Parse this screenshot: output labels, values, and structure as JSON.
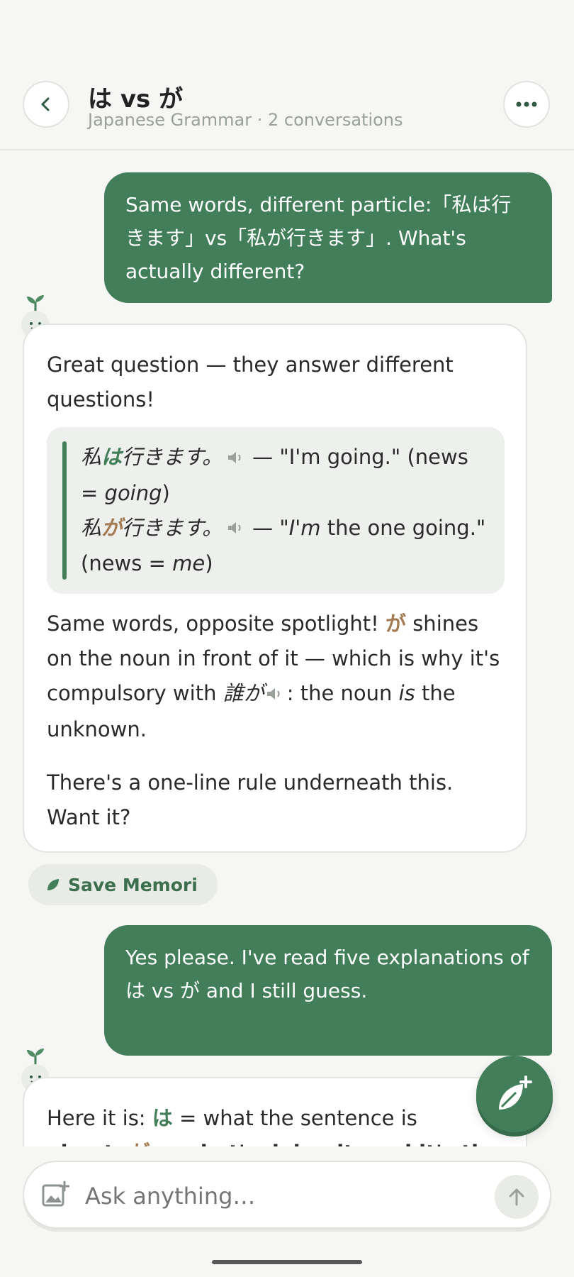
{
  "header": {
    "title": "は vs が",
    "subtitle": "Japanese Grammar · 2 conversations",
    "back_icon": "chevron-left-icon",
    "more_icon": "ellipsis-icon"
  },
  "messages": {
    "user1": "Same words, different particle:「私は行きます」vs「私が行きます」. What's actually different?",
    "bot1": {
      "intro": "Great question — they answer different questions!",
      "q1_pre": "私",
      "q1_particle": "は",
      "q1_post": "行きます。",
      "q1_dash": "— \"I'm going.\" (news = ",
      "q1_em": "going",
      "q1_end": ")",
      "q2_pre": "私",
      "q2_particle": "が",
      "q2_post": "行きます。",
      "q2_dash": "— \"",
      "q2_em": "I'm",
      "q2_mid": " the one going.\" (news = ",
      "q2_em2": "me",
      "q2_end": ")",
      "p2_a": "Same words, opposite spotlight! ",
      "p2_ga": "が",
      "p2_b": " shines on the noun in front of it — which is why it's compulsory with ",
      "p2_jp": "誰が",
      "p2_c": ": the noun ",
      "p2_em": "is",
      "p2_d": " the unknown.",
      "p3": "There's a one-line rule underneath this. Want it?"
    },
    "save_label": "Save Memori",
    "user2": "Yes please. I've read five explanations of は vs が and I still guess.",
    "bot2": {
      "a": "Here it is: ",
      "wa": "は",
      "b": " = what the sentence is",
      "line2_a": "about; ",
      "line2_ga": "が",
      "line2_b": " = what's doing it, and it's the"
    }
  },
  "input": {
    "placeholder": "Ask anything…"
  },
  "colors": {
    "accent": "#417e59",
    "ga": "#a37a52",
    "background": "#f6f6f4"
  }
}
